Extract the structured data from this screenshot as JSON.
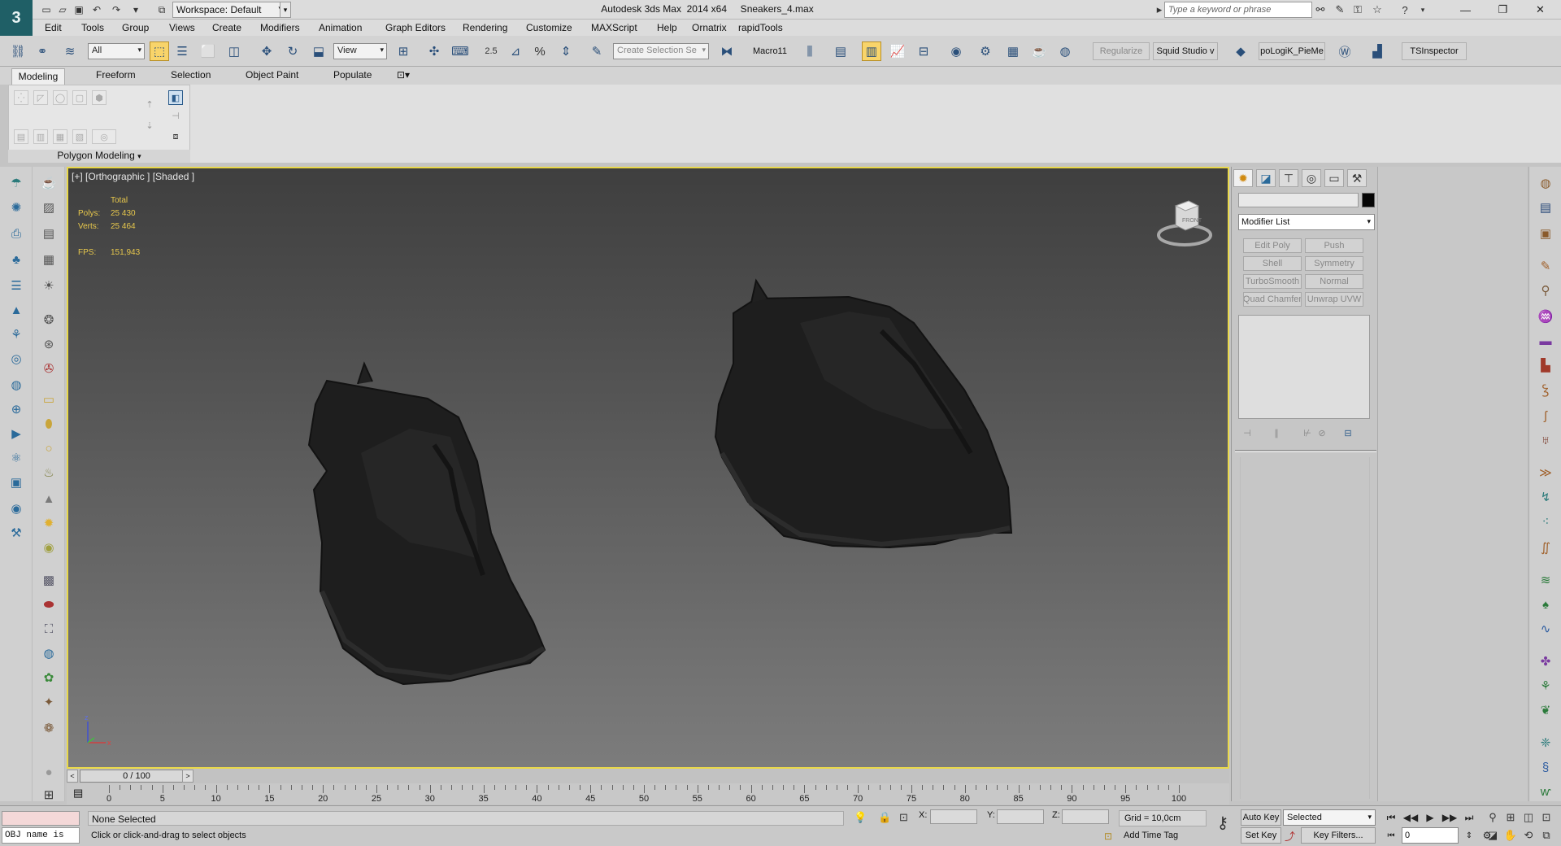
{
  "title_bar": {
    "app_icon": "3ds-max-logo",
    "workspace_label": "Workspace: Default",
    "window_title": "Autodesk 3ds Max  2014 x64     Sneakers_4.max",
    "search_placeholder": "Type a keyword or phrase"
  },
  "menu": [
    "Edit",
    "Tools",
    "Group",
    "Views",
    "Create",
    "Modifiers",
    "Animation",
    "Graph Editors",
    "Rendering",
    "Customize",
    "MAXScript",
    "Help",
    "Ornatrix",
    "rapidTools"
  ],
  "toolbar": {
    "selection_filter": "All",
    "ref_coord": "View",
    "snap_label": "2.5",
    "named_selection_placeholder": "Create Selection Se",
    "macro_label": "Macro11",
    "regularize_label": "Regularize",
    "squid_label": "Squid Studio v",
    "topologik_label": "poLogiK_PieMe",
    "tsinspector_label": "TSInspector"
  },
  "ribbon": {
    "tabs": [
      "Modeling",
      "Freeform",
      "Selection",
      "Object Paint",
      "Populate"
    ],
    "panel_label": "Polygon Modeling"
  },
  "viewport": {
    "label": "[+] [Orthographic ] [Shaded ]",
    "stats": {
      "header": "Total",
      "polys_label": "Polys:",
      "polys": "25 430",
      "verts_label": "Verts:",
      "verts": "25 464",
      "fps_label": "FPS:",
      "fps": "151,943"
    },
    "viewcube_face": "FRONT",
    "axis_x": "x",
    "axis_z": "z"
  },
  "command_panel": {
    "modifier_list": "Modifier List",
    "modifier_buttons": [
      "Edit Poly",
      "Push",
      "Shell",
      "Symmetry",
      "TurboSmooth",
      "Normal",
      "Quad Chamfer",
      "Unwrap UVW"
    ],
    "object_color": "#050505"
  },
  "timeline": {
    "slider_label": "0 / 100",
    "ticks": [
      "0",
      "5",
      "10",
      "15",
      "20",
      "25",
      "30",
      "35",
      "40",
      "45",
      "50",
      "55",
      "60",
      "65",
      "70",
      "75",
      "80",
      "85",
      "90",
      "95",
      "100"
    ]
  },
  "status": {
    "listener_text": "OBJ name is",
    "selection": "None Selected",
    "prompt": "Click or click-and-drag to select objects",
    "x_label": "X:",
    "y_label": "Y:",
    "z_label": "Z:",
    "grid": "Grid = 10,0cm",
    "add_time_tag": "Add Time Tag",
    "auto_key": "Auto Key",
    "set_key": "Set Key",
    "selected": "Selected",
    "key_filters": "Key Filters...",
    "frame": "0"
  }
}
